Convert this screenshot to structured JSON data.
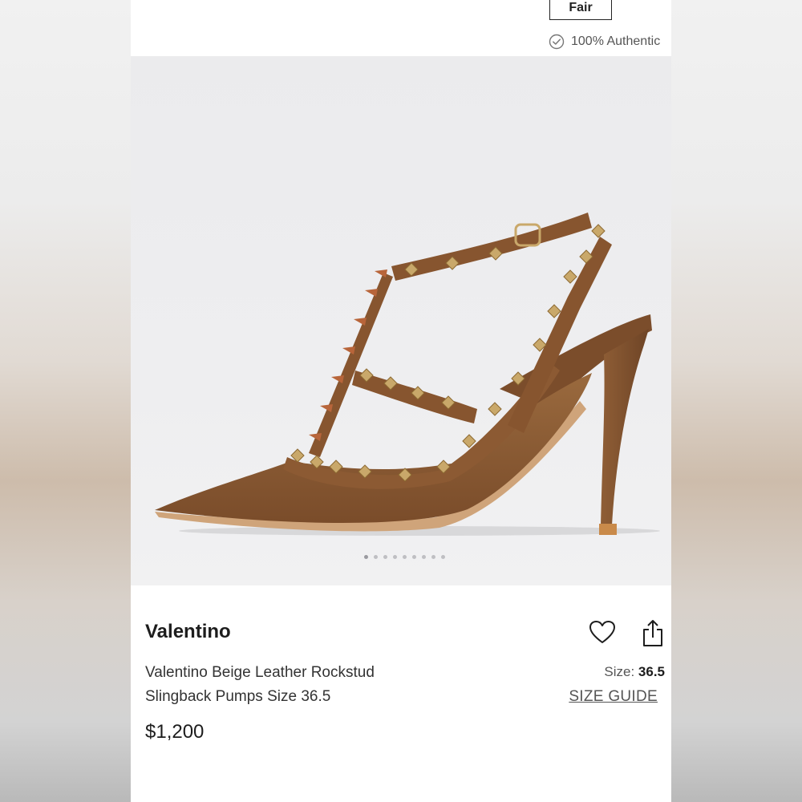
{
  "header": {
    "condition_badge": "Fair",
    "authentic_label": "100% Authentic",
    "authentic_icon": "check-circle-icon"
  },
  "gallery": {
    "image_alt": "brown leather studded slingback pump",
    "image_count": 9,
    "active_index": 0
  },
  "product": {
    "brand": "Valentino",
    "title_line1": "Valentino Beige Leather Rockstud",
    "title_line2": "Slingback Pumps Size 36.5",
    "price": "$1,200",
    "size_label": "Size:",
    "size_value": "36.5",
    "size_guide_label": "SIZE GUIDE"
  },
  "actions": {
    "like_icon": "heart-icon",
    "share_icon": "share-icon"
  },
  "colors": {
    "leather": "#8a5a34",
    "stud": "#c9a86a",
    "text": "#1d1d1d"
  }
}
